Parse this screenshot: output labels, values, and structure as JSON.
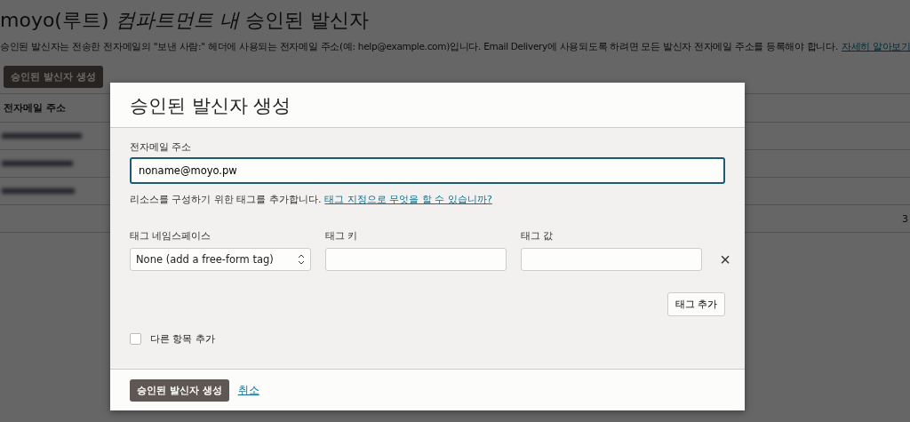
{
  "page": {
    "title": "moyo(루트) *컴파트먼트 내* 승인된 발신자",
    "description": "승인된 발신자는 전송한 전자메일의 \"보낸 사람:\" 헤더에 사용되는 전자메일 주소(예: help@example.com)입니다. Email Delivery에 사용되도록 하려면 모든 발신자 전자메일 주소를 등록해야 합니다.",
    "learn_more_link": "자세히 알아보기",
    "create_button": "승인된 발신자 생성",
    "table": {
      "columns": [
        "전자메일 주소"
      ],
      "rows": [
        {
          "kind": "blurred"
        },
        {
          "kind": "blurred"
        },
        {
          "kind": "blurred"
        }
      ],
      "footer": "3"
    }
  },
  "dialog": {
    "title": "승인된 발신자 생성",
    "email": {
      "label": "전자메일 주소",
      "value": "noname@moyo.pw"
    },
    "tag_hint": "리소스를 구성하기 위한 태그를 추가합니다.",
    "tag_help_link": "태그 지정으로 무엇을 할 수 있습니까?",
    "tag_columns": [
      "태그 네임스페이스",
      "태그 키",
      "태그 값"
    ],
    "tag_row": {
      "namespace": "None (add a free-form tag)"
    },
    "remove_icon": "×",
    "add_tag_button": "태그 추가",
    "add_another": {
      "label": "다른 항목 추가",
      "checked": false
    },
    "submit_button": "승인된 발신자 생성",
    "cancel_link": "취소"
  }
}
